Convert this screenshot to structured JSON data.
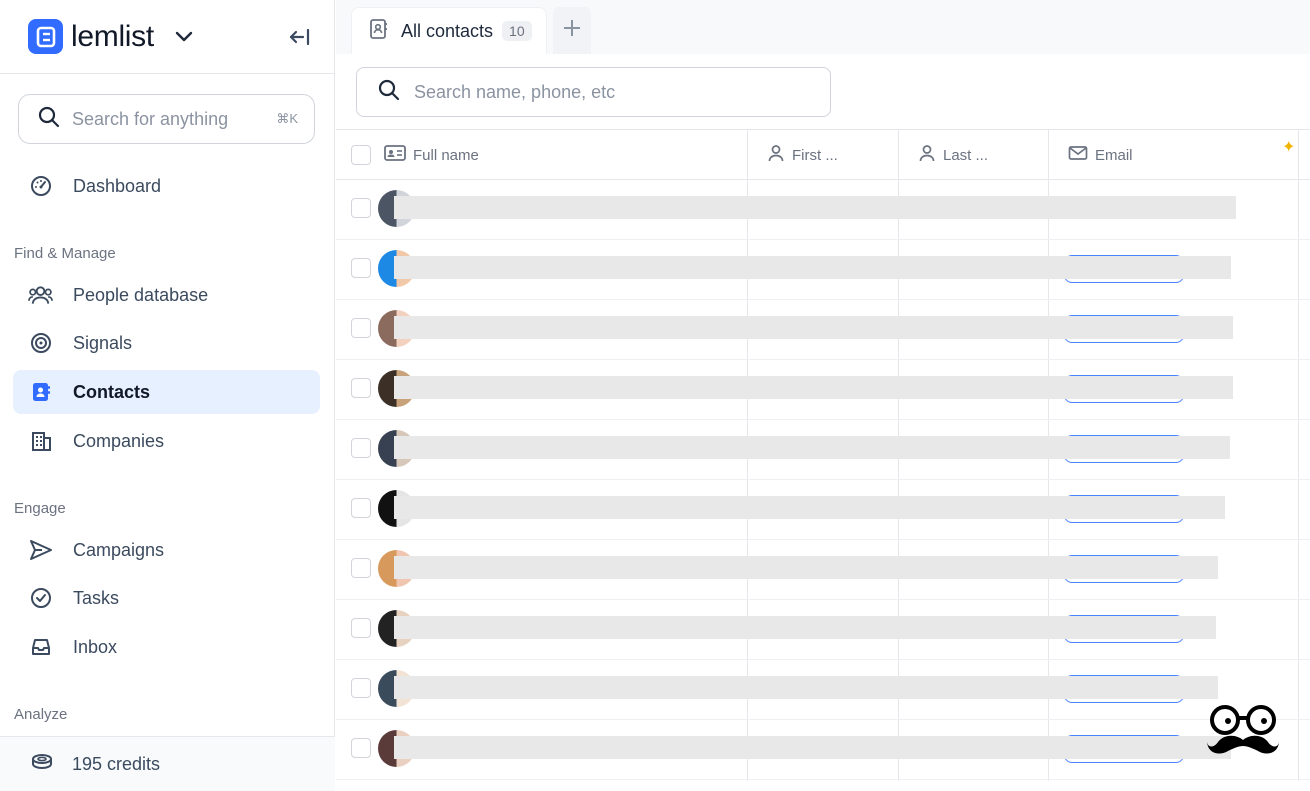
{
  "brand": {
    "name": "lemlist",
    "accent": "#316bff"
  },
  "sidebar": {
    "search_placeholder": "Search for anything",
    "search_shortcut": "⌘K",
    "dashboard": "Dashboard",
    "section_find": "Find & Manage",
    "people_database": "People database",
    "signals": "Signals",
    "contacts": "Contacts",
    "companies": "Companies",
    "section_engage": "Engage",
    "campaigns": "Campaigns",
    "tasks": "Tasks",
    "inbox": "Inbox",
    "section_analyze": "Analyze",
    "credits": "195 credits"
  },
  "main": {
    "tab_label": "All contacts",
    "tab_count": "10",
    "search_placeholder": "Search name, phone, etc",
    "columns": [
      "Full name",
      "First ...",
      "Last ...",
      "Email"
    ],
    "row_count": 10
  }
}
